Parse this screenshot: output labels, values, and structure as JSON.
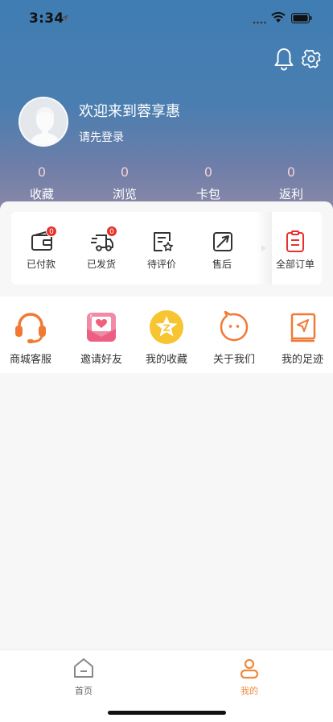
{
  "status": {
    "time": "3:34"
  },
  "profile": {
    "welcome": "欢迎来到蓉享惠",
    "login_hint": "请先登录"
  },
  "stats": [
    {
      "value": "0",
      "label": "收藏"
    },
    {
      "value": "0",
      "label": "浏览"
    },
    {
      "value": "0",
      "label": "卡包"
    },
    {
      "value": "0",
      "label": "返利"
    }
  ],
  "orders": [
    {
      "label": "已付款",
      "icon": "wallet-icon",
      "badge": "0"
    },
    {
      "label": "已发货",
      "icon": "truck-icon",
      "badge": "0"
    },
    {
      "label": "待评价",
      "icon": "review-icon"
    },
    {
      "label": "售后",
      "icon": "after-sale-icon"
    }
  ],
  "orders_all": {
    "label": "全部订单",
    "icon": "order-list-icon"
  },
  "services": [
    {
      "label": "商城客服",
      "icon": "headset-icon"
    },
    {
      "label": "邀请好友",
      "icon": "invite-mail-icon"
    },
    {
      "label": "我的收藏",
      "icon": "star-badge-icon"
    },
    {
      "label": "关于我们",
      "icon": "chat-face-icon"
    },
    {
      "label": "我的足迹",
      "icon": "footprint-book-icon"
    }
  ],
  "tabs": [
    {
      "label": "首页",
      "icon": "home-icon",
      "active": false
    },
    {
      "label": "我的",
      "icon": "profile-icon",
      "active": true
    }
  ],
  "colors": {
    "accent": "#f08a3c",
    "badge": "#e5322d",
    "header_top": "#3f7db3",
    "header_bottom": "#9a8fa8"
  }
}
